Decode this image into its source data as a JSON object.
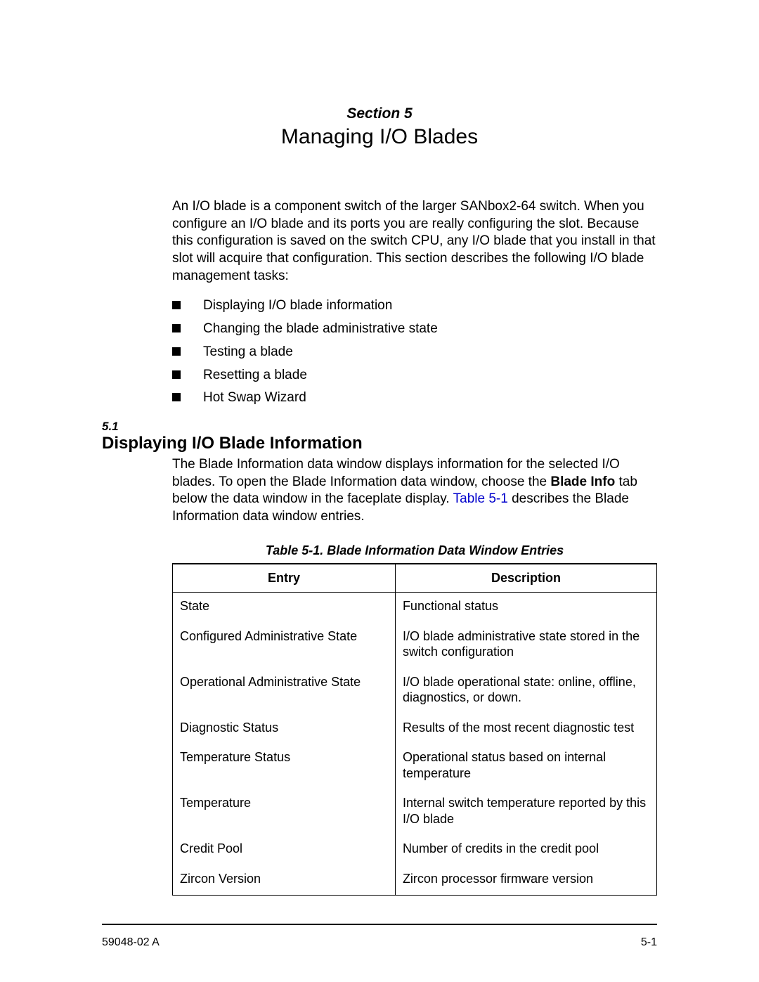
{
  "header": {
    "section_label": "Section 5",
    "section_title": "Managing I/O Blades"
  },
  "intro": "An I/O blade is a component switch of the larger SANbox2-64 switch. When you configure an I/O blade and its ports you are really configuring the slot. Because this configuration is saved on the switch CPU, any I/O blade that you install in that slot will acquire that configuration. This section describes the following I/O blade management tasks:",
  "bullets": [
    "Displaying I/O blade information",
    "Changing the blade administrative state",
    "Testing a blade",
    "Resetting a blade",
    "Hot Swap Wizard"
  ],
  "subsection": {
    "number": "5.1",
    "title": "Displaying I/O Blade Information",
    "para_pre": "The Blade Information data window displays information for the selected I/O blades. To open the Blade Information data window, choose the ",
    "para_bold": "Blade Info",
    "para_mid": " tab below the data window in the faceplate display. ",
    "para_link": "Table 5-1",
    "para_post": " describes the Blade Information data window entries."
  },
  "table": {
    "caption": "Table 5-1. Blade Information Data Window Entries",
    "headers": [
      "Entry",
      "Description"
    ],
    "rows": [
      [
        "State",
        "Functional status"
      ],
      [
        "Configured Administrative State",
        "I/O blade administrative state stored in the switch configuration"
      ],
      [
        "Operational Administrative State",
        "I/O blade operational state: online, offline, diagnostics, or down."
      ],
      [
        "Diagnostic Status",
        "Results of the most recent diagnostic test"
      ],
      [
        "Temperature Status",
        "Operational status based on internal temperature"
      ],
      [
        "Temperature",
        "Internal switch temperature reported by this I/O blade"
      ],
      [
        "Credit Pool",
        "Number of credits in the credit pool"
      ],
      [
        "Zircon Version",
        "Zircon processor firmware version"
      ]
    ]
  },
  "footer": {
    "left": "59048-02 A",
    "right": "5-1"
  }
}
